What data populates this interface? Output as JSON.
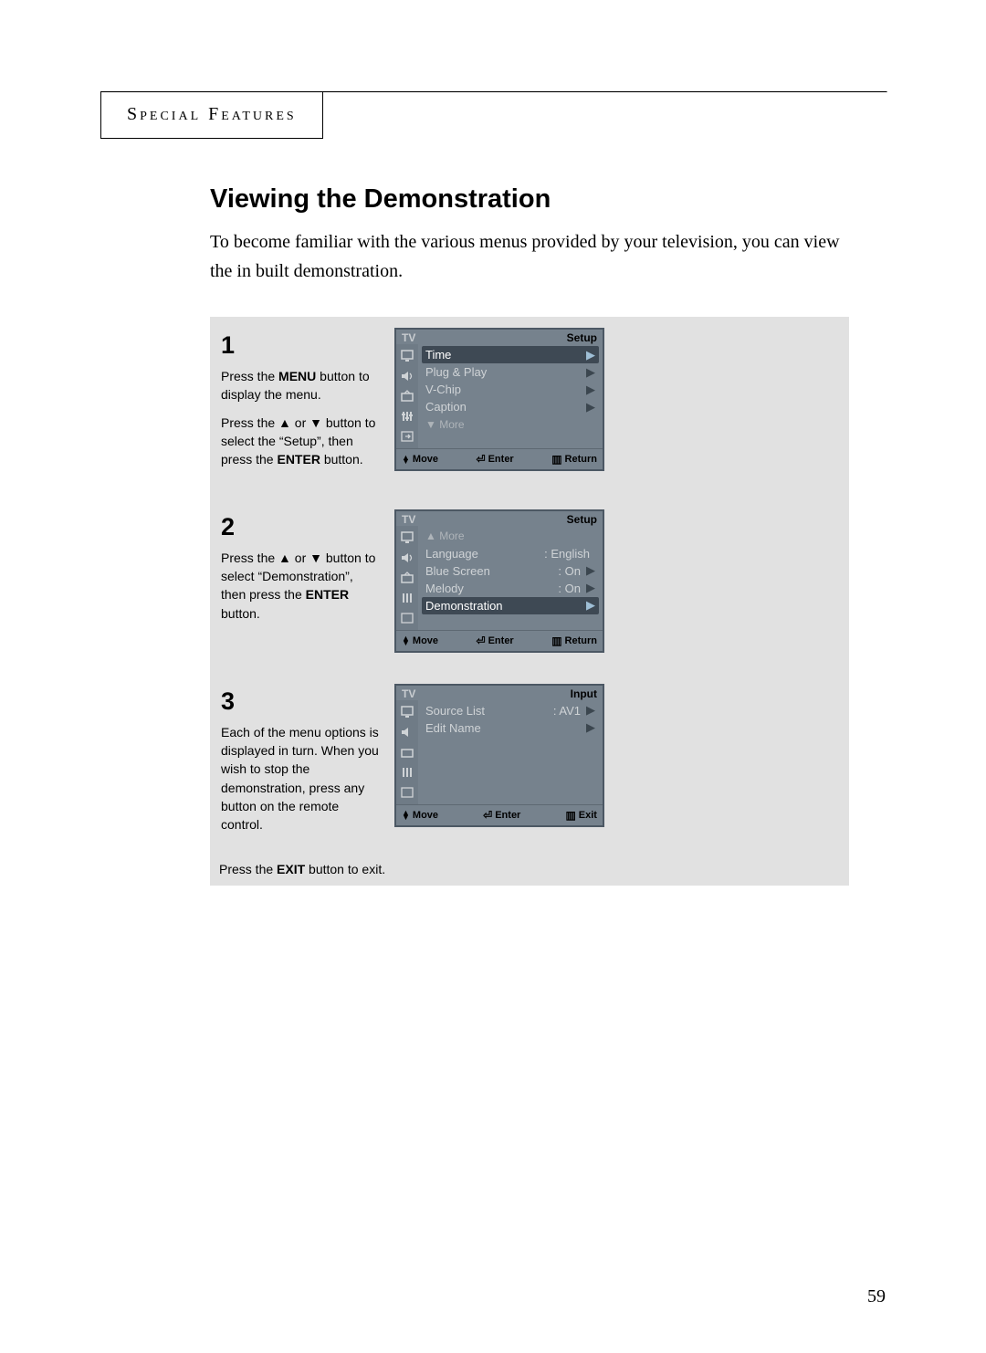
{
  "section": "Special Features",
  "heading": "Viewing the Demonstration",
  "intro": "To become familiar with the various menus provided by your television, you can view the in built demonstration.",
  "page_number": "59",
  "steps": {
    "s1": {
      "num": "1",
      "p1a": "Press the ",
      "p1b": "MENU",
      "p1c": " button to display the menu.",
      "p2a": "Press the ",
      "p2b": " or ",
      "p2c": " button to select the “Setup”, then press the ",
      "p2d": "ENTER",
      "p2e": " button."
    },
    "s2": {
      "num": "2",
      "p1a": "Press the ",
      "p1b": " or ",
      "p1c": " button to select “Demonstration”, then press the ",
      "p1d": "ENTER",
      "p1e": " button."
    },
    "s3": {
      "num": "3",
      "p1": "Each of the menu options is displayed in turn. When you wish to stop the demonstration, press any button on the remote control.",
      "p2a": "Press the ",
      "p2b": "EXIT",
      "p2c": " button to exit."
    }
  },
  "osd1": {
    "tv": "TV",
    "title": "Setup",
    "rows": {
      "time": "Time",
      "plugplay": "Plug & Play",
      "vchip": "V-Chip",
      "caption": "Caption",
      "more": "▼ More"
    },
    "foot": {
      "move": "Move",
      "enter": "Enter",
      "return": "Return"
    }
  },
  "osd2": {
    "tv": "TV",
    "title": "Setup",
    "rows": {
      "more": "▲ More",
      "language": {
        "lbl": "Language",
        "val": ": English"
      },
      "bluescreen": {
        "lbl": "Blue Screen",
        "val": ": On"
      },
      "melody": {
        "lbl": "Melody",
        "val": ": On"
      },
      "demonstration": "Demonstration"
    },
    "foot": {
      "move": "Move",
      "enter": "Enter",
      "return": "Return"
    }
  },
  "osd3": {
    "tv": "TV",
    "title": "Input",
    "rows": {
      "sourcelist": {
        "lbl": "Source List",
        "val": ": AV1"
      },
      "editname": "Edit Name"
    },
    "foot": {
      "move": "Move",
      "enter": "Enter",
      "exit": "Exit"
    }
  },
  "symbols": {
    "up": "▲",
    "down": "▼",
    "updown": "▲▼",
    "right": "▶",
    "enter": "↵",
    "menu": "☰"
  }
}
